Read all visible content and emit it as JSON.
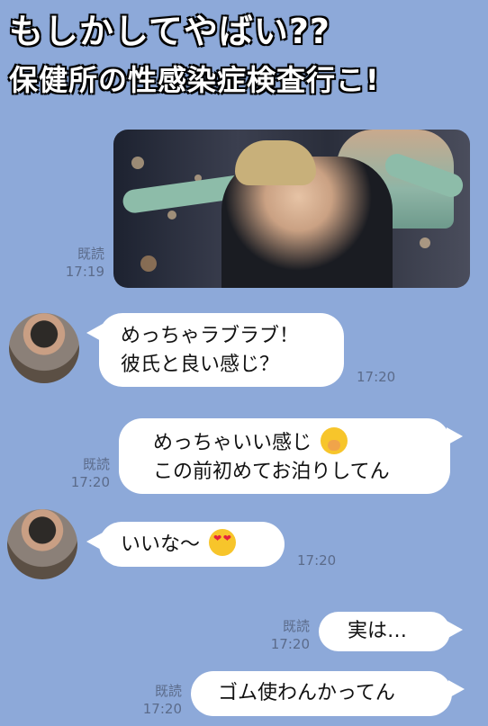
{
  "headline": {
    "line1": "もしかしてやばい??",
    "line2": "保健所の性感染症検査行こ!"
  },
  "messages": {
    "m1": {
      "read": "既読",
      "time": "17:19"
    },
    "m2": {
      "line1": "めっちゃラブラブ！",
      "line2": "彼氏と良い感じ？",
      "time": "17:20"
    },
    "m3": {
      "line1": "めっちゃいい感じ",
      "line2": "この前初めてお泊りしてん",
      "emoji": "hand-over-mouth-emoji",
      "read": "既読",
      "time": "17:20"
    },
    "m4": {
      "line1": "いいな〜",
      "emoji": "heart-eyes-emoji",
      "time": "17:20"
    },
    "m5": {
      "line1": "実は…",
      "read": "既読",
      "time": "17:20"
    },
    "m6": {
      "line1": "ゴム使わんかってん",
      "read": "既読",
      "time": "17:20"
    }
  },
  "colors": {
    "background": "#8da9d9",
    "bubble": "#ffffff",
    "meta_text": "#5b6b8a"
  }
}
